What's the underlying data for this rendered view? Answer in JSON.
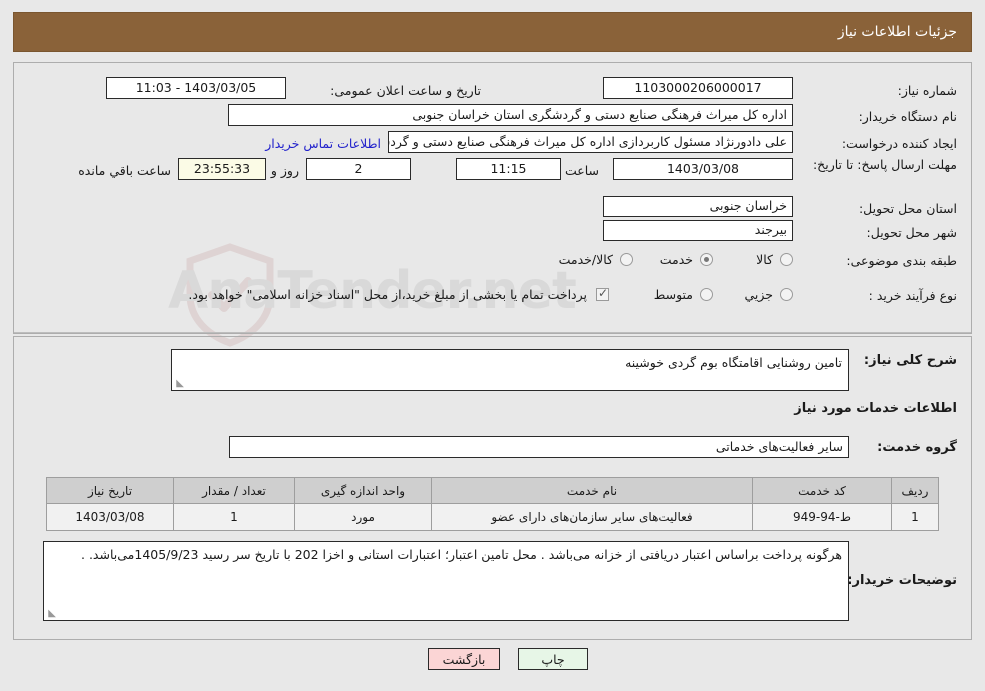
{
  "header": {
    "title": "جزئیات اطلاعات نیاز"
  },
  "form": {
    "need_number_label": "شماره نیاز:",
    "need_number_value": "1103000206000017",
    "announce_label": "تاریخ و ساعت اعلان عمومی:",
    "announce_value": "11:03 - 1403/03/05",
    "buyer_org_label": "نام دستگاه خریدار:",
    "buyer_org_value": "اداره کل میراث فرهنگی  صنایع دستی و گردشگری استان خراسان جنوبی",
    "requester_label": "ایجاد کننده درخواست:",
    "requester_value": "علی دادورنژاد مسئول کاربردازی اداره کل میراث فرهنگی  صنایع دستی و گردشگ",
    "contact_link": "اطلاعات تماس خریدار",
    "deadline_label": "مهلت ارسال پاسخ: تا تاریخ:",
    "deadline_date": "1403/03/08",
    "deadline_hour_label": "ساعت",
    "deadline_hour": "11:15",
    "days_remaining": "2",
    "days_word": "روز و",
    "time_remaining": "23:55:33",
    "remaining_suffix": "ساعت باقي مانده",
    "province_label": "استان محل تحویل:",
    "province_value": "خراسان جنوبی",
    "city_label": "شهر محل تحویل:",
    "city_value": "بیرجند",
    "category_label": "طبقه بندی موضوعی:",
    "category_options": [
      {
        "label": "کالا",
        "selected": false
      },
      {
        "label": "خدمت",
        "selected": true
      },
      {
        "label": "کالا/خدمت",
        "selected": false
      }
    ],
    "process_label": "نوع فرآیند خرید :",
    "process_options": [
      {
        "label": "جزیي",
        "selected": false
      },
      {
        "label": "متوسط",
        "selected": false
      }
    ],
    "islamic_treasury_checked": true,
    "islamic_treasury_text": "پرداخت تمام یا بخشی از مبلغ خرید،از محل \"اسناد خزانه اسلامی\" خواهد بود."
  },
  "details": {
    "general_need_label": "شرح کلی نیاز:",
    "general_need_value": "تامین روشنایی اقامتگاه بوم گردی خوشینه",
    "services_section_title": "اطلاعات خدمات مورد نیاز",
    "service_group_label": "گروه خدمت:",
    "service_group_value": "سایر فعالیت‌های خدماتی",
    "buyer_notes_label": "توضیحات خریدار:",
    "buyer_notes_value": "هرگونه پرداخت براساس اعتبار دریافتی از خزانه می‌باشد . محل تامین اعتبار؛ اعتبارات استانی و اخزا 202  با تاریخ سر رسید 1405/9/23می‌باشد. ."
  },
  "table": {
    "headers": [
      "ردیف",
      "کد خدمت",
      "نام خدمت",
      "واحد اندازه گیری",
      "تعداد / مقدار",
      "تاریخ نیاز"
    ],
    "rows": [
      {
        "index": "1",
        "code": "ط-94-949",
        "name": "فعالیت‌های سایر سازمان‌های دارای عضو",
        "unit": "مورد",
        "qty": "1",
        "date": "1403/03/08"
      }
    ]
  },
  "buttons": {
    "print": "چاپ",
    "back": "بازگشت"
  },
  "watermark": {
    "text": "AnaTender.net"
  }
}
